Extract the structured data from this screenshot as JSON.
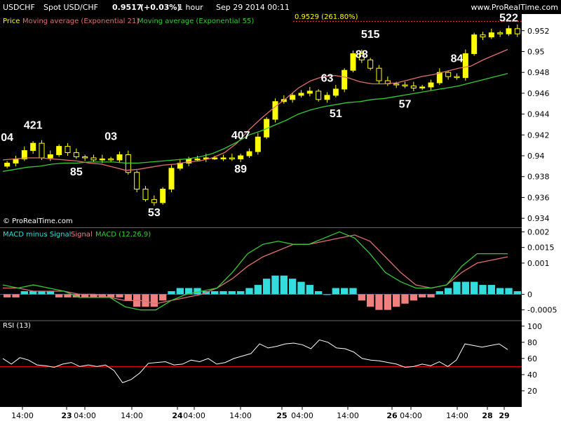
{
  "header": {
    "symbol": "USDCHF",
    "instrument": "Spot USD/CHF",
    "price": "0.9517",
    "change": "(+0.03%)",
    "timeframe": "1 hour",
    "datetime": "Sep 29 2014 00:11",
    "brand": "www.ProRealTime.com"
  },
  "watermark": "© ProRealTime.com",
  "colors": {
    "background": "#000000",
    "axis_panel": "#ffffff",
    "price_up": "#ffff00",
    "ema21": "#e07070",
    "ema55": "#33cc33",
    "macd_pos": "#33dddd",
    "macd_neg": "#f08080",
    "rsi_line": "#ffffff",
    "rsi_level": "#ff0000"
  },
  "legends": {
    "price": [
      "Price",
      "Moving average (Exponential 21)",
      "Moving average (Exponential 55)"
    ],
    "macd": [
      "MACD minus Signal",
      "Signal",
      "MACD (12,26,9)"
    ],
    "rsi": [
      "RSI (13)"
    ]
  },
  "annotation": "0.9529 (261.80%)",
  "chart_data": [
    {
      "type": "line",
      "panel": "price",
      "x_ticks": [
        "14:00",
        "23",
        "04:00",
        "14:00",
        "24",
        "04:00",
        "14:00",
        "25",
        "04:00",
        "14:00",
        "26",
        "04:00",
        "14:00",
        "28",
        "29"
      ],
      "y_ticks": [
        "0.952",
        "0.95",
        "0.948",
        "0.946",
        "0.944",
        "0.942",
        "0.94",
        "0.938",
        "0.936",
        "0.934"
      ],
      "ylim": [
        0.9332,
        0.9536
      ],
      "series": [
        {
          "name": "Price",
          "values": [
            0.9393,
            0.9397,
            0.9405,
            0.9412,
            0.9398,
            0.9401,
            0.9409,
            0.9403,
            0.9399,
            0.9398,
            0.9396,
            0.9397,
            0.9396,
            0.9401,
            0.9384,
            0.9368,
            0.9358,
            0.9355,
            0.9368,
            0.9388,
            0.9393,
            0.9397,
            0.9397,
            0.9398,
            0.9398,
            0.9398,
            0.9397,
            0.94,
            0.9404,
            0.9418,
            0.9435,
            0.9452,
            0.9454,
            0.9458,
            0.946,
            0.9462,
            0.9454,
            0.9458,
            0.9464,
            0.9482,
            0.9498,
            0.9492,
            0.9484,
            0.9472,
            0.9469,
            0.9468,
            0.9467,
            0.9465,
            0.9466,
            0.947,
            0.948,
            0.9476,
            0.9475,
            0.9498,
            0.9516,
            0.9514,
            0.9518,
            0.9517,
            0.9522,
            0.9517
          ]
        },
        {
          "name": "Moving average (Exponential 21)",
          "values": [
            0.9396,
            0.9397,
            0.9398,
            0.9398,
            0.9397,
            0.9396,
            0.9395,
            0.9393,
            0.9392,
            0.9389,
            0.9386,
            0.9387,
            0.9389,
            0.9391,
            0.9392,
            0.9394,
            0.9395,
            0.9398,
            0.9403,
            0.9412,
            0.9425,
            0.9436,
            0.9446,
            0.9455,
            0.9465,
            0.9472,
            0.9476,
            0.9477,
            0.9475,
            0.9471,
            0.9469,
            0.9469,
            0.947,
            0.9473,
            0.9476,
            0.9478,
            0.9481,
            0.9484,
            0.9486,
            0.9492,
            0.9497,
            0.9502
          ]
        },
        {
          "name": "Moving average (Exponential 55)",
          "values": [
            0.9385,
            0.9387,
            0.9389,
            0.939,
            0.9392,
            0.9393,
            0.9393,
            0.9394,
            0.9394,
            0.9394,
            0.9393,
            0.9393,
            0.9394,
            0.9395,
            0.9396,
            0.9397,
            0.9399,
            0.9402,
            0.9407,
            0.9413,
            0.942,
            0.9424,
            0.9429,
            0.9434,
            0.944,
            0.9444,
            0.9447,
            0.9449,
            0.9451,
            0.9452,
            0.9454,
            0.9455,
            0.9457,
            0.9459,
            0.9461,
            0.9463,
            0.9465,
            0.9467,
            0.947,
            0.9473,
            0.9476,
            0.9479
          ]
        }
      ],
      "labels": [
        {
          "text": "04",
          "x_index": 0,
          "y": 0.9414
        },
        {
          "text": "421",
          "x_index": 3,
          "y": 0.9426
        },
        {
          "text": "85",
          "x_index": 8,
          "y": 0.9381
        },
        {
          "text": "03",
          "x_index": 12,
          "y": 0.9415
        },
        {
          "text": "53",
          "x_index": 17,
          "y": 0.9342
        },
        {
          "text": "407",
          "x_index": 27,
          "y": 0.9416
        },
        {
          "text": "89",
          "x_index": 27,
          "y": 0.9384
        },
        {
          "text": "63",
          "x_index": 37,
          "y": 0.9471
        },
        {
          "text": "51",
          "x_index": 38,
          "y": 0.9437
        },
        {
          "text": "515",
          "x_index": 42,
          "y": 0.9513
        },
        {
          "text": "88",
          "x_index": 41,
          "y": 0.9494
        },
        {
          "text": "57",
          "x_index": 46,
          "y": 0.9446
        },
        {
          "text": "84",
          "x_index": 52,
          "y": 0.949
        },
        {
          "text": "522",
          "x_index": 58,
          "y": 0.9529
        }
      ]
    },
    {
      "type": "bar",
      "panel": "macd",
      "y_ticks": [
        "0.002",
        "0.0015",
        "0.001",
        "0.0005",
        "0",
        "-0.0005"
      ],
      "ylim": [
        -0.0008,
        0.0021
      ],
      "series": [
        {
          "name": "MACD minus Signal",
          "values": [
            -0.0001,
            -0.0001,
            0.0001,
            0.0001,
            0.0001,
            0.0001,
            -0.0001,
            -0.0001,
            -0.0001,
            -0.0001,
            -0.0001,
            -0.0001,
            -0.0001,
            -0.0001,
            -0.0002,
            -0.0004,
            -0.0004,
            -0.0004,
            -0.0002,
            0.0001,
            0.0002,
            0.0002,
            0.0002,
            0.0001,
            0.0001,
            0.0001,
            0.0001,
            0.0001,
            0.0002,
            0.0003,
            0.0005,
            0.0006,
            0.0006,
            0.0005,
            0.0004,
            0.0003,
            0.0001,
            0.0,
            0.0002,
            0.0002,
            0.0002,
            -0.0002,
            -0.0004,
            -0.0005,
            -0.0005,
            -0.0004,
            -0.0003,
            -0.0002,
            -0.0001,
            -0.0001,
            0.0001,
            0.0002,
            0.0004,
            0.0004,
            0.0004,
            0.0003,
            0.0003,
            0.0002,
            0.0002,
            0.0001
          ]
        },
        {
          "name": "Signal",
          "values": [
            0.0002,
            0.0002,
            0.0001,
            0.0001,
            0.0001,
            0.0,
            0.0,
            -0.0001,
            -0.0002,
            -0.0002,
            -0.0003,
            -0.0002,
            -0.0001,
            0.0,
            0.0002,
            0.0005,
            0.0009,
            0.0012,
            0.0014,
            0.0016,
            0.0016,
            0.0017,
            0.0018,
            0.0019,
            0.0017,
            0.0012,
            0.0007,
            0.0003,
            0.0002,
            0.0003,
            0.0007,
            0.001,
            0.0011,
            0.0012
          ]
        },
        {
          "name": "MACD (12,26,9)",
          "values": [
            0.0003,
            0.0002,
            0.0003,
            0.0002,
            0.0001,
            -0.0001,
            -0.0001,
            -0.0001,
            -0.0004,
            -0.0005,
            -0.0005,
            -0.0002,
            0.0,
            0.0001,
            0.0002,
            0.0007,
            0.0013,
            0.0016,
            0.0017,
            0.0016,
            0.0016,
            0.0018,
            0.002,
            0.0018,
            0.0013,
            0.0007,
            0.0004,
            0.0002,
            0.0002,
            0.0003,
            0.0009,
            0.0013,
            0.0013,
            0.0013
          ]
        }
      ]
    },
    {
      "type": "line",
      "panel": "rsi",
      "y_ticks": [
        "100",
        "80",
        "60",
        "40",
        "20"
      ],
      "ylim": [
        0,
        105
      ],
      "level": 50,
      "series": [
        {
          "name": "RSI (13)",
          "values": [
            60,
            53,
            61,
            58,
            52,
            51,
            49,
            53,
            55,
            50,
            52,
            50,
            52,
            45,
            30,
            34,
            42,
            54,
            55,
            56,
            52,
            53,
            58,
            56,
            60,
            53,
            55,
            60,
            63,
            66,
            78,
            73,
            75,
            78,
            79,
            77,
            72,
            83,
            80,
            73,
            72,
            68,
            60,
            58,
            57,
            55,
            53,
            49,
            50,
            53,
            51,
            56,
            50,
            58,
            78,
            76,
            74,
            76,
            78,
            71
          ]
        }
      ]
    }
  ]
}
